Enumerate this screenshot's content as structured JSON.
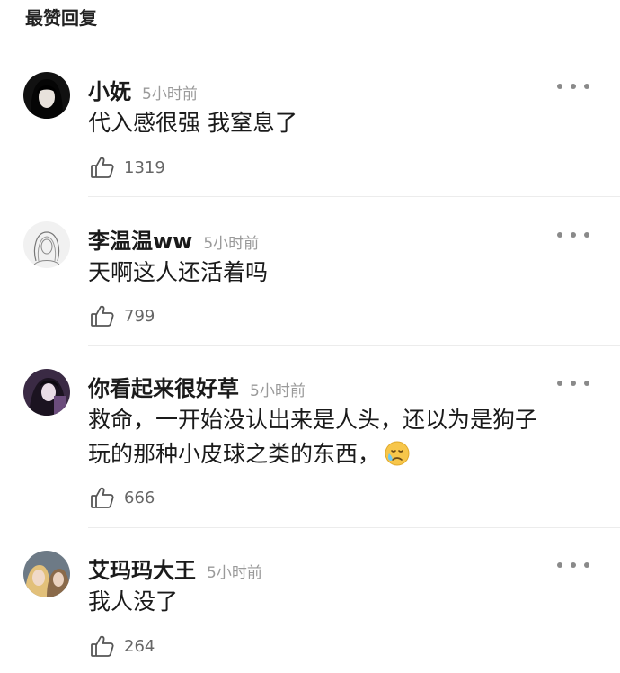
{
  "section_title": "最赞回复",
  "comments": [
    {
      "username": "小妩",
      "time": "5小时前",
      "text": "代入感很强 我窒息了",
      "likes": "1319",
      "avatar_icon": "avatar-dark-hair"
    },
    {
      "username": "李温温ww",
      "time": "5小时前",
      "text": "天啊这人还活着吗",
      "likes": "799",
      "avatar_icon": "avatar-sketch-girl"
    },
    {
      "username": "你看起来很好草",
      "time": "5小时前",
      "text_line1": "救命，一开始没认出来是人头，还以为是狗子",
      "text_line2": "玩的那种小皮球之类的东西，",
      "emoji_icon": "sad-sweat-emoji",
      "likes": "666",
      "avatar_icon": "avatar-anime-purple"
    },
    {
      "username": "艾玛玛大王",
      "time": "5小时前",
      "text": "我人没了",
      "likes": "264",
      "avatar_icon": "avatar-two-people"
    }
  ],
  "icons": {
    "like": "thumbs-up-icon",
    "more": "more-dots-icon"
  },
  "colors": {
    "text": "#1a1a1a",
    "muted": "#9a9a9a",
    "divider": "#ececec"
  }
}
